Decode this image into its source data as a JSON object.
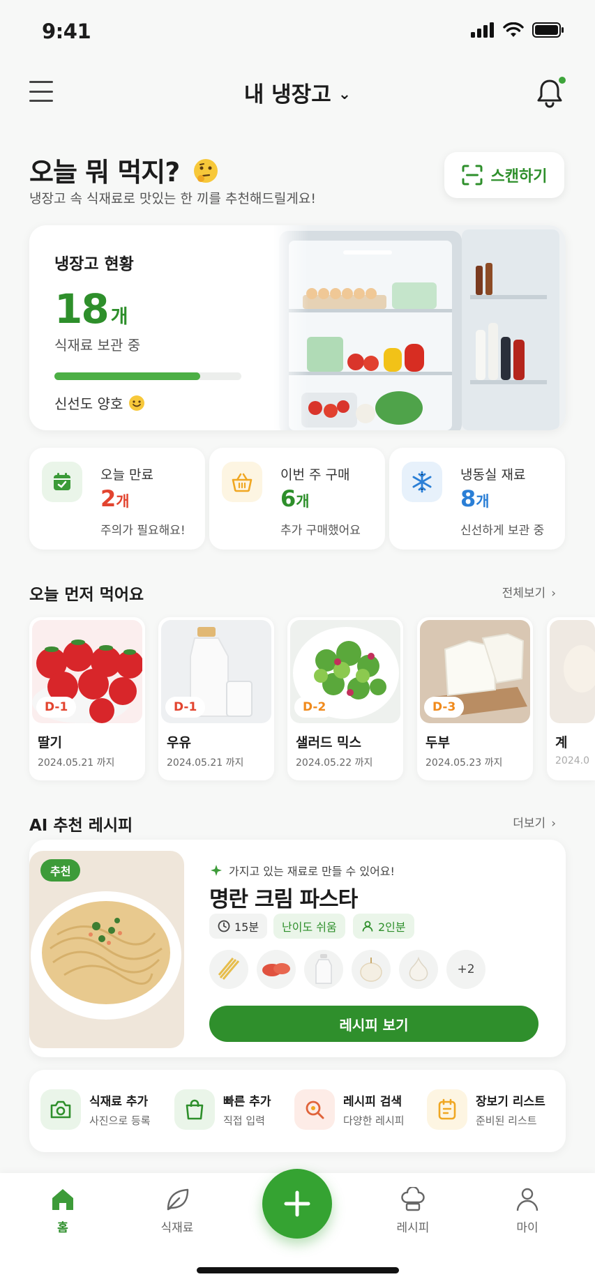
{
  "status_bar": {
    "time": "9:41"
  },
  "header": {
    "title": "내 냉장고"
  },
  "greeting": {
    "title": "오늘 뭐 먹지?",
    "subtitle": "냉장고 속 식재료로 맛있는 한 끼를 추천해드릴게요!",
    "scan_label": "스캔하기"
  },
  "fridge_status": {
    "title": "냉장고 현황",
    "count": "18",
    "unit": "개",
    "label": "식재료 보관 중",
    "freshness_label": "신선도 양호",
    "freshness_fraction": 0.78
  },
  "stats": [
    {
      "title": "오늘 만료",
      "value": "2",
      "unit": "개",
      "note": "주의가 필요해요!",
      "icon": "calendar-icon",
      "color": "#e2442f"
    },
    {
      "title": "이번 주 구매",
      "value": "6",
      "unit": "개",
      "note": "추가 구매했어요",
      "icon": "basket-icon",
      "color": "#2e8f2b"
    },
    {
      "title": "냉동실 재료",
      "value": "8",
      "unit": "개",
      "note": "신선하게 보관 중",
      "icon": "snowflake-icon",
      "color": "#2b7fd6"
    }
  ],
  "eat_first": {
    "title": "오늘 먼저 먹어요",
    "more_label": "전체보기",
    "items": [
      {
        "name": "딸기",
        "badge": "D-1",
        "date": "2024.05.21 까지",
        "badge_color": "#e2442f"
      },
      {
        "name": "우유",
        "badge": "D-1",
        "date": "2024.05.21 까지",
        "badge_color": "#e2442f"
      },
      {
        "name": "샐러드 믹스",
        "badge": "D-2",
        "date": "2024.05.22 까지",
        "badge_color": "#f08a1c"
      },
      {
        "name": "두부",
        "badge": "D-3",
        "date": "2024.05.23 까지",
        "badge_color": "#f08a1c"
      },
      {
        "name": "계",
        "badge": "",
        "date": "2024.0",
        "badge_color": "#f08a1c"
      }
    ]
  },
  "ai_recipe": {
    "title": "AI 추천 레시피",
    "more_label": "더보기",
    "tag": "추천",
    "hint": "가지고 있는 재료로 만들 수 있어요!",
    "name": "명란 크림 파스타",
    "time": "15분",
    "difficulty": "난이도 쉬움",
    "servings": "2인분",
    "extra_ingredients": "+2",
    "button_label": "레시피 보기"
  },
  "quick_actions": [
    {
      "title": "식재료 추가",
      "sub": "사진으로 등록",
      "icon": "camera-icon"
    },
    {
      "title": "빠른 추가",
      "sub": "직접 입력",
      "icon": "shopping-bag-icon"
    },
    {
      "title": "레시피 검색",
      "sub": "다양한 레시피",
      "icon": "search-icon"
    },
    {
      "title": "장보기 리스트",
      "sub": "준비된 리스트",
      "icon": "note-icon"
    }
  ],
  "bottom_nav": {
    "home": "홈",
    "ingredients": "식재료",
    "recipes": "레시피",
    "my": "마이"
  },
  "colors": {
    "brand": "#2e8f2b",
    "danger": "#e2442f",
    "warning": "#f08a1c",
    "info": "#2b7fd6"
  }
}
